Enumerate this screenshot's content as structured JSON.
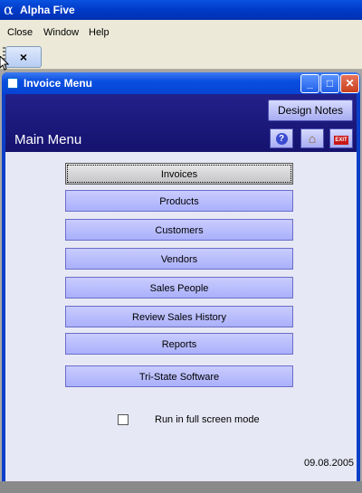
{
  "app": {
    "logo": "α",
    "title": "Alpha Five"
  },
  "menubar": {
    "items": [
      "Close",
      "Window",
      "Help"
    ]
  },
  "toolbar": {
    "close_glyph": "×"
  },
  "window": {
    "title": "Invoice Menu",
    "controls": {
      "minimize": "_",
      "maximize": "□",
      "close": "✕"
    }
  },
  "header": {
    "design_notes": "Design Notes",
    "title": "Main Menu",
    "help_glyph": "?",
    "home_glyph": "⌂",
    "exit_glyph": "EXIT"
  },
  "menu": {
    "buttons": [
      "Invoices",
      "Products",
      "Customers",
      "Vendors",
      "Sales People",
      "Review Sales History",
      "Reports",
      "Tri-State Software"
    ]
  },
  "options": {
    "fullscreen_label": "Run in full screen mode",
    "fullscreen_checked": false
  },
  "footer": {
    "date": "09.08.2005"
  }
}
